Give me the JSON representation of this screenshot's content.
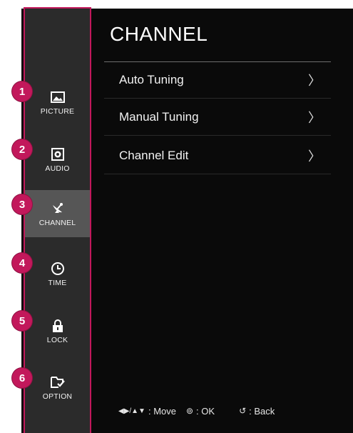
{
  "sidebar": {
    "items": [
      {
        "number": "1",
        "label": "PICTURE",
        "icon": "picture-icon",
        "active": false
      },
      {
        "number": "2",
        "label": "AUDIO",
        "icon": "speaker-icon",
        "active": false
      },
      {
        "number": "3",
        "label": "CHANNEL",
        "icon": "satellite-dish-icon",
        "active": true
      },
      {
        "number": "4",
        "label": "TIME",
        "icon": "clock-icon",
        "active": false
      },
      {
        "number": "5",
        "label": "LOCK",
        "icon": "lock-icon",
        "active": false
      },
      {
        "number": "6",
        "label": "OPTION",
        "icon": "option-checkbox-icon",
        "active": false
      }
    ]
  },
  "panel": {
    "title": "CHANNEL",
    "items": [
      {
        "label": "Auto Tuning",
        "chevron": "〉"
      },
      {
        "label": "Manual Tuning",
        "chevron": "〉"
      },
      {
        "label": "Channel Edit",
        "chevron": "〉"
      }
    ]
  },
  "footer": {
    "move_symbols": "◀▶/▲▼",
    "move_label": ": Move",
    "ok_symbol": "⊚",
    "ok_label": ": OK",
    "back_symbol": "↺",
    "back_label": ": Back"
  },
  "colors": {
    "accent": "#c2185b",
    "sidebar_bg": "#2b2b2b",
    "active_bg": "#565656",
    "screen_bg": "#0a0a0a"
  }
}
